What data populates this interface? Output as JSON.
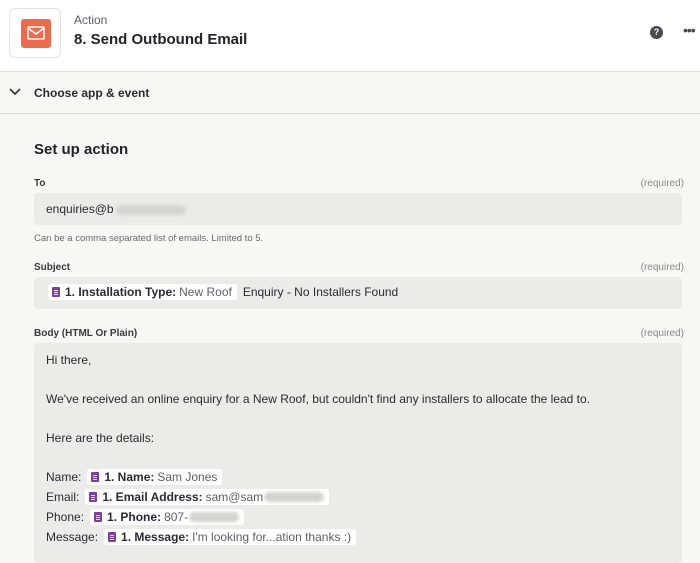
{
  "header": {
    "kicker": "Action",
    "title": "8. Send Outbound Email",
    "help_glyph": "?",
    "more_glyph": "•••",
    "app_icon": "email-envelope-icon",
    "app_icon_color": "#ee6a48"
  },
  "collapse": {
    "label": "Choose app & event"
  },
  "setup": {
    "title": "Set up action",
    "to": {
      "label": "To",
      "required": "(required)",
      "value": "enquiries@b",
      "helper": "Can be a comma separated list of emails. Limited to 5."
    },
    "subject": {
      "label": "Subject",
      "required": "(required)",
      "pill_label": "1. Installation Type:",
      "pill_value": "New Roof",
      "suffix": "Enquiry - No Installers Found"
    },
    "body": {
      "label": "Body (HTML Or Plain)",
      "required": "(required)",
      "greeting": "Hi there,",
      "intro": "We've received an online enquiry for a New Roof, but couldn't find any installers to allocate the lead to.",
      "details_heading": "Here are the details:",
      "rows": [
        {
          "prefix": "Name:",
          "pill_label": "1. Name:",
          "pill_value": "Sam Jones"
        },
        {
          "prefix": "Email:",
          "pill_label": "1. Email Address:",
          "pill_value": "sam@sam"
        },
        {
          "prefix": "Phone:",
          "pill_label": "1. Phone:",
          "pill_value": "807-"
        },
        {
          "prefix": "Message:",
          "pill_label": "1. Message:",
          "pill_value": "I'm looking for...ation thanks :)"
        }
      ]
    }
  },
  "colors": {
    "pill_icon": "#7b3fa6",
    "field_bg": "#ebebe9",
    "page_bg": "#f7f7f5"
  }
}
